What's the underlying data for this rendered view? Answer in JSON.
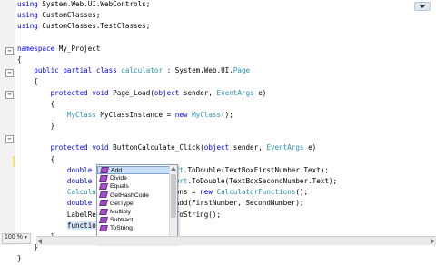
{
  "editor": {
    "lines": [
      {
        "parts": [
          [
            "kw",
            "using"
          ],
          [
            "t",
            " System.Web.UI.WebControls;"
          ]
        ]
      },
      {
        "parts": [
          [
            "kw",
            "using"
          ],
          [
            "t",
            " CustomClasses;"
          ]
        ]
      },
      {
        "parts": [
          [
            "kw",
            "using"
          ],
          [
            "t",
            " CustomClasses.TestClasses;"
          ]
        ]
      },
      {
        "parts": []
      },
      {
        "parts": [
          [
            "kw",
            "namespace"
          ],
          [
            "t",
            " My_Project"
          ]
        ]
      },
      {
        "parts": [
          [
            "t",
            "{"
          ]
        ]
      },
      {
        "parts": [
          [
            "t",
            "    "
          ],
          [
            "kw",
            "public"
          ],
          [
            "t",
            " "
          ],
          [
            "kw",
            "partial"
          ],
          [
            "t",
            " "
          ],
          [
            "kw",
            "class"
          ],
          [
            "t",
            " "
          ],
          [
            "ty",
            "calculator"
          ],
          [
            "t",
            " : System.Web.UI."
          ],
          [
            "ty",
            "Page"
          ]
        ]
      },
      {
        "parts": [
          [
            "t",
            "    {"
          ]
        ]
      },
      {
        "parts": [
          [
            "t",
            "        "
          ],
          [
            "kw",
            "protected"
          ],
          [
            "t",
            " "
          ],
          [
            "kw",
            "void"
          ],
          [
            "t",
            " Page_Load("
          ],
          [
            "kw",
            "object"
          ],
          [
            "t",
            " sender, "
          ],
          [
            "ty",
            "EventArgs"
          ],
          [
            "t",
            " e)"
          ]
        ]
      },
      {
        "parts": [
          [
            "t",
            "        {"
          ]
        ]
      },
      {
        "parts": [
          [
            "t",
            "            "
          ],
          [
            "ty",
            "MyClass"
          ],
          [
            "t",
            " MyClassInstance = "
          ],
          [
            "kw",
            "new"
          ],
          [
            "t",
            " "
          ],
          [
            "ty",
            "MyClass"
          ],
          [
            "t",
            "();"
          ]
        ]
      },
      {
        "parts": [
          [
            "t",
            "        }"
          ]
        ]
      },
      {
        "parts": []
      },
      {
        "parts": [
          [
            "t",
            "        "
          ],
          [
            "kw",
            "protected"
          ],
          [
            "t",
            " "
          ],
          [
            "kw",
            "void"
          ],
          [
            "t",
            " ButtonCalculate_Click("
          ],
          [
            "kw",
            "object"
          ],
          [
            "t",
            " sender, "
          ],
          [
            "ty",
            "EventArgs"
          ],
          [
            "t",
            " e)"
          ]
        ]
      },
      {
        "parts": [
          [
            "t",
            "        {"
          ]
        ]
      },
      {
        "parts": [
          [
            "t",
            "            "
          ],
          [
            "kw",
            "double"
          ],
          [
            "t",
            " FirstNumber = "
          ],
          [
            "ty",
            "Convert"
          ],
          [
            "t",
            ".ToDouble(TextBoxFirstNumber.Text);"
          ]
        ]
      },
      {
        "parts": [
          [
            "t",
            "            "
          ],
          [
            "kw",
            "double"
          ],
          [
            "t",
            " SecondNumber = "
          ],
          [
            "ty",
            "Convert"
          ],
          [
            "t",
            ".ToDouble(TextBoxSecondNumber.Text);"
          ]
        ]
      },
      {
        "parts": [
          [
            "t",
            "            "
          ],
          [
            "ty",
            "CalculatorFunctions"
          ],
          [
            "t",
            " functions = "
          ],
          [
            "kw",
            "new"
          ],
          [
            "t",
            " "
          ],
          [
            "ty",
            "CalculatorFunctions"
          ],
          [
            "t",
            "();"
          ]
        ]
      },
      {
        "parts": [
          [
            "t",
            "            "
          ],
          [
            "kw",
            "double"
          ],
          [
            "t",
            " Result = Functions.Add(FirstNumber, SecondNumber);"
          ]
        ]
      },
      {
        "parts": [
          [
            "t",
            "            LabelResult.Text = Result.ToString();"
          ]
        ]
      },
      {
        "parts": [
          [
            "t",
            "            "
          ],
          [
            "hl",
            "functions."
          ],
          [
            "caret",
            ""
          ]
        ]
      },
      {
        "parts": [
          [
            "t",
            "        }"
          ]
        ]
      },
      {
        "parts": [
          [
            "t",
            "    }"
          ]
        ]
      },
      {
        "parts": [
          [
            "t",
            "}"
          ]
        ]
      }
    ]
  },
  "intellisense": {
    "items": [
      "Add",
      "Divide",
      "Equals",
      "GetHashCode",
      "GetType",
      "Multiply",
      "Subtract",
      "ToString"
    ],
    "selected": "Add",
    "item_icon": "method-icon"
  },
  "statusbar": {
    "zoom": "100 %"
  },
  "colors": {
    "keyword": "#0000ff",
    "type": "#2b91af",
    "selection": "#c5ddf7"
  }
}
